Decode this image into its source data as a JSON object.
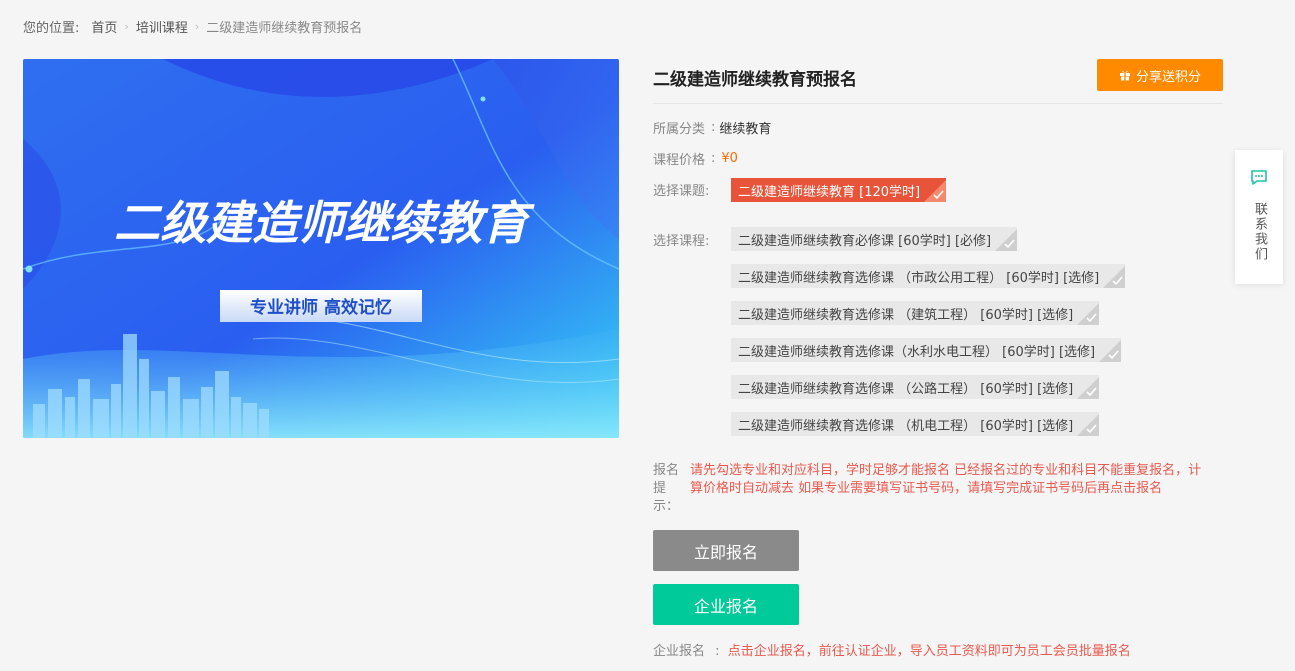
{
  "breadcrumb": {
    "prefix": "您的位置:",
    "items": [
      "首页",
      "培训课程"
    ],
    "current": "二级建造师继续教育预报名"
  },
  "banner": {
    "headline": "二级建造师继续教育",
    "slogan": "专业讲师 高效记忆"
  },
  "course": {
    "title": "二级建造师继续教育预报名",
    "share_label": "分享送积分",
    "category_label": "所属分类",
    "category_value": "继续教育",
    "price_label": "课程价格",
    "price_value": "¥0",
    "topic_label": "选择课题:",
    "topic": "二级建造师继续教育 [120学时]",
    "courses_label": "选择课程:",
    "courses": [
      "二级建造师继续教育必修课 [60学时] [必修]",
      "二级建造师继续教育选修课 （市政公用工程） [60学时] [选修]",
      "二级建造师继续教育选修课 （建筑工程） [60学时] [选修]",
      "二级建造师继续教育选修课（水利水电工程） [60学时] [选修]",
      "二级建造师继续教育选修课 （公路工程） [60学时] [选修]",
      "二级建造师继续教育选修课 （机电工程） [60学时] [选修]"
    ],
    "tip_label": "报名提示：",
    "tip_text": "请先勾选专业和对应科目，学时足够才能报名 已经报名过的专业和科目不能重复报名，计算价格时自动减去 如果专业需要填写证书号码，请填写完成证书号码后再点击报名",
    "enroll_label": "立即报名",
    "enterprise_label": "企业报名",
    "enterprise_tip_label": "企业报名",
    "enterprise_tip": "点击企业报名，前往认证企业，导入员工资料即可为员工会员批量报名"
  },
  "contact": {
    "label": "联系我们"
  },
  "colors": {
    "accent_orange": "#ff8a00",
    "tag_red": "#e8543a",
    "enterprise_green": "#00c99a",
    "tip_red": "#e85a4f"
  }
}
